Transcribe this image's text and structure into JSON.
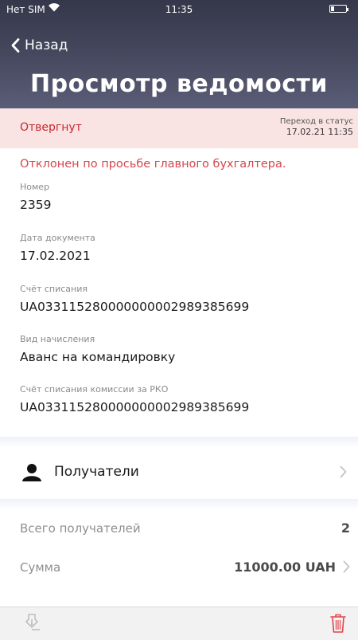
{
  "status_bar": {
    "carrier": "Нет SIM",
    "time": "11:35"
  },
  "nav": {
    "back_label": "Назад",
    "title": "Просмотр ведомости"
  },
  "status": {
    "label": "Отвергнут",
    "transition_label": "Переход в статус",
    "transition_date": "17.02.21  11:35",
    "color": "#c9272f",
    "reason": "Отклонен по просьбе главного бухгалтера."
  },
  "fields": [
    {
      "label": "Номер",
      "value": "2359"
    },
    {
      "label": "Дата документа",
      "value": "17.02.2021"
    },
    {
      "label": "Счёт списания",
      "value": "UA033115280000000002989385699"
    },
    {
      "label": "Вид начисления",
      "value": "Аванс на командировку"
    },
    {
      "label": "Счёт списания комиссии за РКО",
      "value": "UA033115280000000002989385699"
    }
  ],
  "recipients": {
    "label": "Получатели"
  },
  "summary": {
    "total_label": "Всего получателей",
    "total_value": "2",
    "sum_label": "Сумма",
    "sum_value": "11000.00 UAH"
  },
  "toolbar": {
    "sign_icon": "sign-document-icon",
    "delete_icon": "trash-icon",
    "delete_color": "#e0444b"
  }
}
